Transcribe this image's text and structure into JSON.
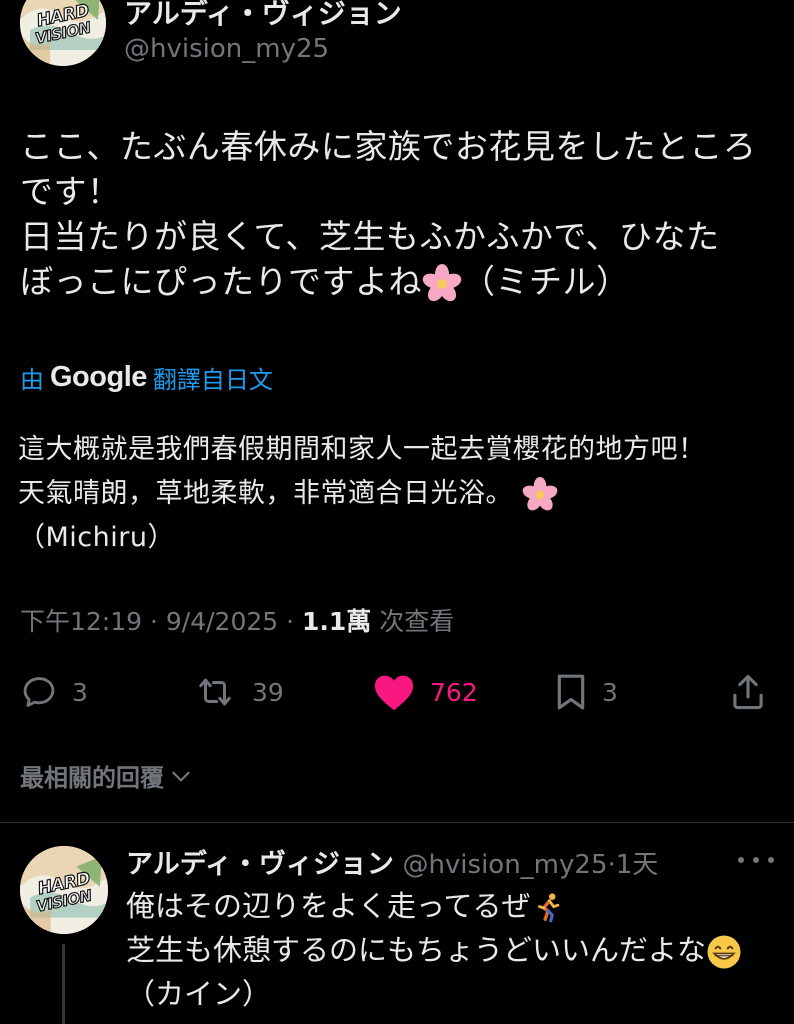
{
  "tweet": {
    "author": {
      "name": "アルディ・ヴィジョン",
      "handle": "@hvision_my25",
      "avatar_logo_lines": [
        "HARD",
        "VISION"
      ]
    },
    "text_lines": [
      "ここ、たぶん春休みに家族でお花見をしたところ",
      "です！",
      "日当たりが良くて、芝生もふかふかで、ひなた",
      "ぼっこにぴったりですよね"
    ],
    "text_last_suffix": "（ミチル）",
    "emoji": "cherry-blossom",
    "translation": {
      "prefix": "由",
      "provider": "Google",
      "label": "翻譯自日文",
      "lines": [
        "這大概就是我們春假期間和家人一起去賞櫻花的地方吧！",
        "天氣晴朗，草地柔軟，非常適合日光浴。"
      ],
      "last_line": "（Michiru）"
    },
    "meta": {
      "time": "下午12:19 · 9/4/2025 · ",
      "views_count": "1.1萬",
      "views_label": " 次查看"
    },
    "actions": {
      "reply_count": "3",
      "retweet_count": "39",
      "like_count": "762",
      "bookmark_count": "3",
      "liked": true,
      "like_color": "#f91880"
    }
  },
  "replies_section": {
    "label": "最相關的回覆"
  },
  "reply": {
    "name": "アルディ・ヴィジョン",
    "handle": "@hvision_my25",
    "dot": "·",
    "time": "1天",
    "text_lines": [
      "俺はその辺りをよく走ってるぜ",
      "芝生も休憩するのにもちょうどいいんだよな",
      "（カイン）"
    ],
    "emojis": [
      "runner",
      "grinning-face"
    ]
  },
  "colors": {
    "background": "#000000",
    "text": "#e7e9ea",
    "secondary": "#71767b",
    "link": "#1d9bf0",
    "divider": "#2f3336"
  }
}
